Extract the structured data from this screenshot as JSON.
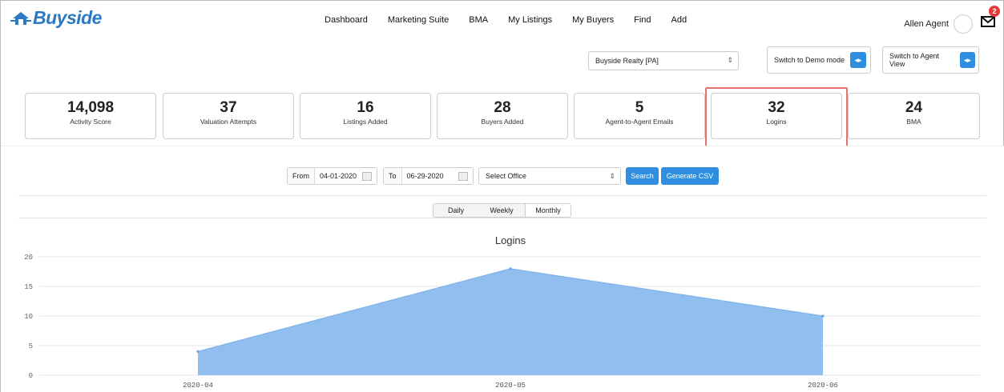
{
  "app": {
    "logo_text": "Buyside"
  },
  "nav": {
    "items": [
      "Dashboard",
      "Marketing Suite",
      "BMA",
      "My Listings",
      "My Buyers",
      "Find",
      "Add"
    ]
  },
  "user": {
    "name": "Allen Agent",
    "notification_count": "2"
  },
  "controls": {
    "agency_select": "Buyside Realty [PA]",
    "switch_demo": "Switch to Demo mode",
    "switch_agent": "Switch to Agent View"
  },
  "stats": [
    {
      "value": "14,098",
      "label": "Activity Score"
    },
    {
      "value": "37",
      "label": "Valuation Attempts"
    },
    {
      "value": "16",
      "label": "Listings Added"
    },
    {
      "value": "28",
      "label": "Buyers Added"
    },
    {
      "value": "5",
      "label": "Agent-to-Agent Emails"
    },
    {
      "value": "32",
      "label": "Logins"
    },
    {
      "value": "24",
      "label": "BMA"
    }
  ],
  "filters": {
    "from_label": "From",
    "from_value": "04-01-2020",
    "to_label": "To",
    "to_value": "06-29-2020",
    "office_select": "Select Office",
    "search_label": "Search",
    "csv_label": "Generate CSV"
  },
  "period_tabs": {
    "items": [
      "Daily",
      "Weekly",
      "Monthly"
    ],
    "active": "Monthly"
  },
  "chart_data": {
    "type": "area",
    "title": "Logins",
    "x": [
      "2020-04",
      "2020-05",
      "2020-06"
    ],
    "series": [
      {
        "values": [
          4,
          18,
          10
        ]
      }
    ],
    "ylim": [
      0,
      20
    ],
    "yticks": [
      0,
      5,
      10,
      15,
      20
    ],
    "grid": true,
    "color": "#90bfef"
  }
}
